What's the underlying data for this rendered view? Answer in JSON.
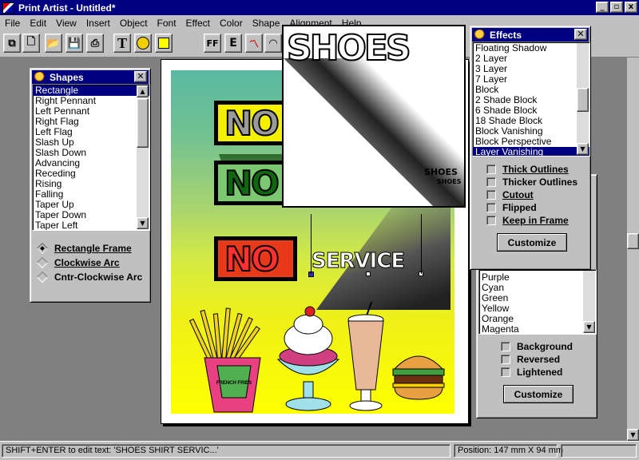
{
  "window": {
    "title": "Print Artist - Untitled*",
    "min_label": "_",
    "max_label": "▫",
    "close_label": "x"
  },
  "menu": [
    "File",
    "Edit",
    "View",
    "Insert",
    "Object",
    "Font",
    "Effect",
    "Color",
    "Shape",
    "Alignment",
    "Help"
  ],
  "toolbar": {
    "text_tool": "T",
    "font_tool": "FF",
    "edit_tool": "E"
  },
  "poster": {
    "no_text": "NO",
    "service_text": "SERVICE",
    "fries_label": "FRENCH FRIES"
  },
  "shapes_panel": {
    "title": "Shapes",
    "items": [
      "Rectangle",
      "Right Pennant",
      "Left Pennant",
      "Right Flag",
      "Left Flag",
      "Slash Up",
      "Slash Down",
      "Advancing",
      "Receding",
      "Rising",
      "Falling",
      "Taper Up",
      "Taper Down",
      "Taper Left"
    ],
    "selected_index": 0,
    "options": [
      "Rectangle Frame",
      "Clockwise Arc",
      "Cntr-Clockwise Arc"
    ],
    "option_selected_index": 0
  },
  "effects_panel": {
    "title": "Effects",
    "items": [
      "Floating Shadow",
      "2 Layer",
      "3 Layer",
      "7 Layer",
      "Block",
      "2 Shade Block",
      "6 Shade Block",
      "18 Shade Block",
      "Block Vanishing",
      "Block Perspective",
      "Layer Vanishing"
    ],
    "selected_index": 10,
    "checkboxes": [
      "Thick Outlines",
      "Thicker Outlines",
      "Cutout",
      "Flipped",
      "Keep in Frame"
    ],
    "customize_label": "Customize"
  },
  "preview": {
    "big_text": "SHOES",
    "small_text": "SHOES",
    "tiny_text": "SHOES"
  },
  "colors_panel": {
    "items": [
      "Purple",
      "Cyan",
      "Green",
      "Yellow",
      "Orange",
      "Magenta"
    ],
    "checkboxes": [
      "Background",
      "Reversed",
      "Lightened"
    ],
    "customize_label": "Customize"
  },
  "status": {
    "hint": "SHIFT+ENTER to edit text: 'SHOES  SHIRT  SERVIC...'",
    "position": "Position: 147 mm X 94 mm"
  },
  "colors": {
    "title_blue": "#000080",
    "face_gray": "#c0c0c0",
    "desk_gray": "#808080"
  }
}
